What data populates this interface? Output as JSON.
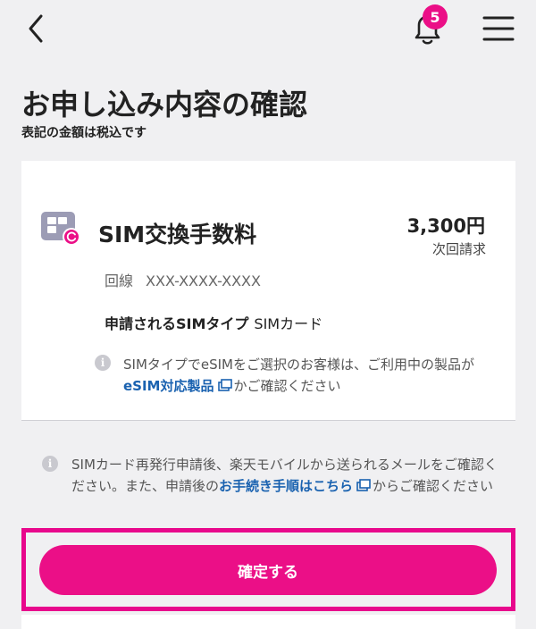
{
  "header": {
    "back_icon": "chevron-left-icon",
    "notification_icon": "bell-icon",
    "notification_count": "5",
    "menu_icon": "hamburger-menu-icon"
  },
  "page": {
    "title": "お申し込み内容の確認",
    "subtitle": "表記の金額は税込です"
  },
  "order_item": {
    "icon": "sim-card-icon",
    "name": "SIM交換手数料",
    "price": "3,300円",
    "billing": "次回請求",
    "line_label": "回線",
    "line_value": "XXX-XXXX-XXXX",
    "sim_type_label": "申請されるSIMタイプ",
    "sim_type_value": "SIMカード",
    "note_prefix": "SIMタイプでeSIMをご選択のお客様は、ご利用中の製品が",
    "note_link": "eSIM対応製品",
    "note_suffix": "かご確認ください"
  },
  "reissue_note": {
    "prefix": "SIMカード再発行申請後、楽天モバイルから送られるメールをご確認ください。また、申請後の",
    "link": "お手続き手順はこちら",
    "suffix": "からご確認ください"
  },
  "actions": {
    "confirm_label": "確定する"
  },
  "colors": {
    "accent": "#eb0f87",
    "link": "#1a62b0",
    "background": "#f0f0f2"
  }
}
